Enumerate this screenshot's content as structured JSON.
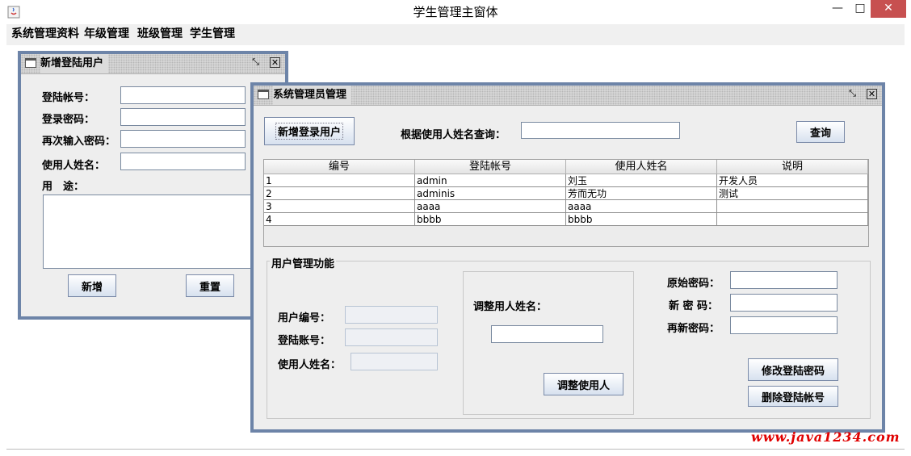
{
  "window": {
    "title": "学生管理主窗体",
    "min_glyph": "—",
    "max_glyph": "□",
    "close_glyph": "✕"
  },
  "menubar": [
    "系统管理资料",
    "年级管理",
    "班级管理",
    "学生管理"
  ],
  "add_user_frame": {
    "title": "新增登陆用户",
    "labels": {
      "account": "登陆帐号：",
      "password": "登录密码：",
      "password_again": "再次输入密码：",
      "user_name": "使用人姓名：",
      "purpose": "用　途："
    },
    "values": {
      "account": "",
      "password": "",
      "password_again": "",
      "user_name": "",
      "purpose": ""
    },
    "buttons": {
      "add": "新增",
      "reset": "重置"
    }
  },
  "admin_frame": {
    "title": "系统管理员管理",
    "add_login_user_label": "新增登录用户",
    "search_label": "根据使用人姓名查询：",
    "search_value": "",
    "query_label": "查询",
    "table": {
      "headers": [
        "编号",
        "登陆帐号",
        "使用人姓名",
        "说明"
      ],
      "rows": [
        [
          "1",
          "admin",
          "刘玉",
          "开发人员"
        ],
        [
          "2",
          "adminis",
          "芳而无功",
          "测试"
        ],
        [
          "3",
          "aaaa",
          "aaaa",
          ""
        ],
        [
          "4",
          "bbbb",
          "bbbb",
          ""
        ]
      ]
    },
    "group": {
      "title": "用户管理功能",
      "user_id_label": "用户编号：",
      "account_label": "登陆账号：",
      "user_name_label": "使用人姓名：",
      "adjust_name_label": "调整用人姓名：",
      "adjust_button": "调整使用人",
      "old_pwd_label": "原始密码：",
      "new_pwd_label": "新 密 码：",
      "renew_pwd_label": "再新密码：",
      "modify_pwd_button": "修改登陆密码",
      "delete_account_button": "删除登陆帐号"
    }
  },
  "watermark": "www.java1234.com",
  "colors": {
    "frame_border": "#6d84a8",
    "close_red": "#c75050",
    "watermark": "#e00000"
  }
}
